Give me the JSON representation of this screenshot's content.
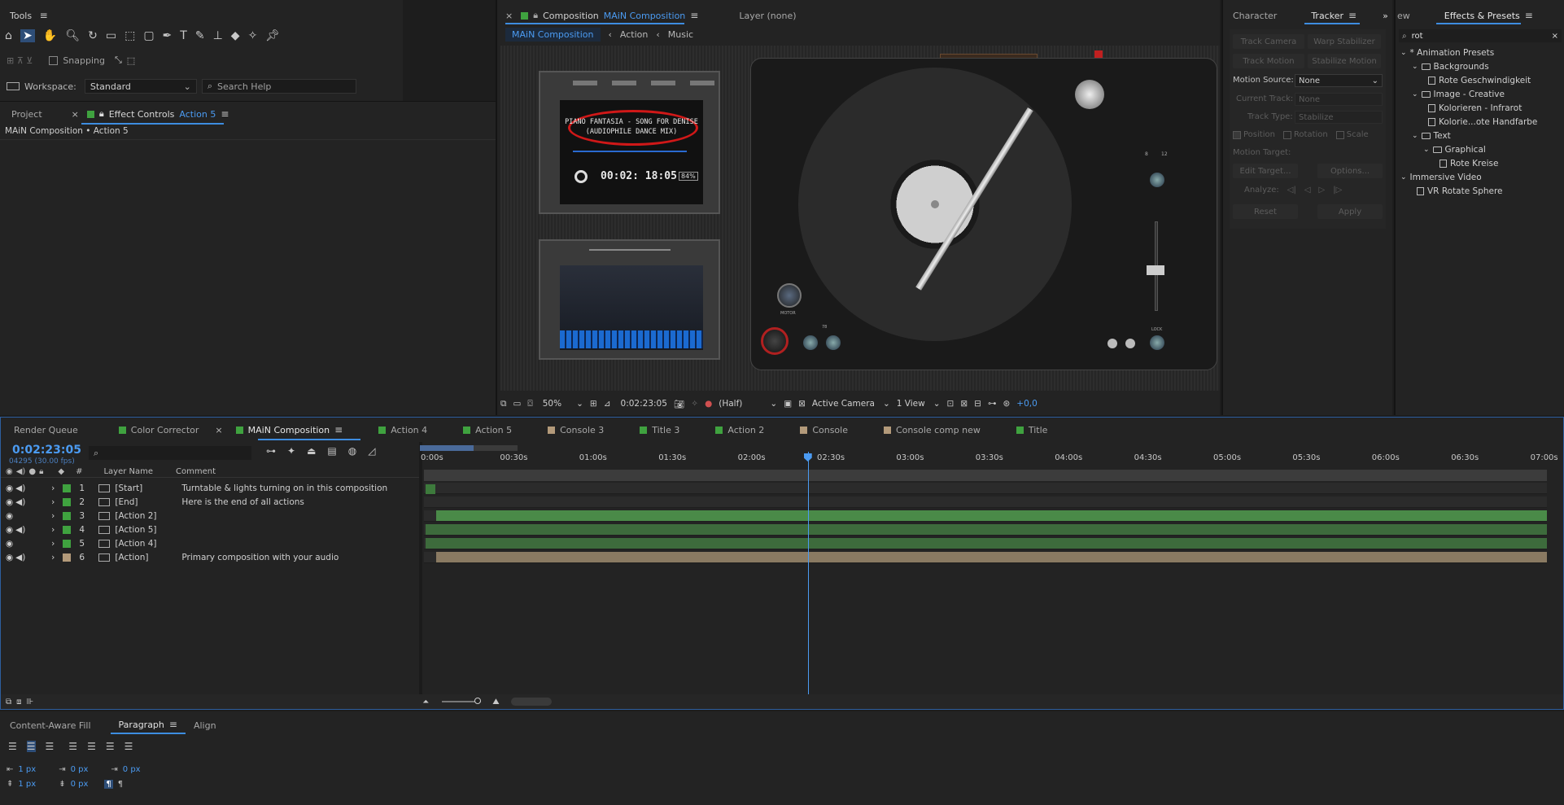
{
  "tools": {
    "title": "Tools",
    "snapping_label": "Snapping",
    "workspace_label": "Workspace:",
    "workspace_value": "Standard",
    "search_placeholder": "Search Help"
  },
  "project_panel": {
    "tabs": [
      "Project",
      "Effect Controls",
      "Action 5"
    ],
    "breadcrumb": "MAiN Composition • Action 5"
  },
  "comp_viewer": {
    "title_prefix": "Composition",
    "title_name": "MAiN Composition",
    "layer_tab": "Layer (none)",
    "breadcrumbs": [
      "MAiN Composition",
      "Action",
      "Music"
    ],
    "screen_line1": "PIANO FANTASIA - SONG FOR DENISE",
    "screen_line2": "(AUDIOPHILE DANCE MIX)",
    "screen_time": "00:02: 18:05",
    "screen_pct": "84%",
    "label_motor": "MOTOR",
    "label_lock": "LOCK",
    "label_78": "78",
    "label_8": "8",
    "label_12": "12",
    "footer": {
      "zoom": "50%",
      "timecode": "0:02:23:05",
      "resolution": "(Half)",
      "camera": "Active Camera",
      "views": "1 View",
      "exposure": "+0,0"
    }
  },
  "tracker": {
    "tabs": [
      "Character",
      "Tracker"
    ],
    "buttons": [
      "Track Camera",
      "Warp Stabilizer",
      "Track Motion",
      "Stabilize Motion"
    ],
    "motion_source_label": "Motion Source:",
    "motion_source_value": "None",
    "current_track_label": "Current Track:",
    "current_track_value": "None",
    "track_type_label": "Track Type:",
    "track_type_value": "Stabilize",
    "checkboxes": [
      "Position",
      "Rotation",
      "Scale"
    ],
    "motion_target_label": "Motion Target:",
    "edit_target": "Edit Target...",
    "options": "Options...",
    "analyze_label": "Analyze:",
    "reset": "Reset",
    "apply": "Apply"
  },
  "effects": {
    "tabs": [
      "ew",
      "Effects & Presets"
    ],
    "search_value": "rot",
    "tree": [
      {
        "label": "* Animation Presets",
        "kind": "group"
      },
      {
        "label": "Backgrounds",
        "kind": "folder"
      },
      {
        "label": "Rote Geschwindigkeit",
        "kind": "preset"
      },
      {
        "label": "Image - Creative",
        "kind": "folder"
      },
      {
        "label": "Kolorieren - Infrarot",
        "kind": "preset"
      },
      {
        "label": "Kolorie...ote Handfarbe",
        "kind": "preset"
      },
      {
        "label": "Text",
        "kind": "folder"
      },
      {
        "label": "Graphical",
        "kind": "folder"
      },
      {
        "label": "Rote Kreise",
        "kind": "preset"
      },
      {
        "label": "Immersive Video",
        "kind": "group"
      },
      {
        "label": "VR Rotate Sphere",
        "kind": "preset"
      }
    ]
  },
  "timeline": {
    "tabs": [
      {
        "label": "Render Queue",
        "color": ""
      },
      {
        "label": "Color Corrector",
        "color": "#3fa23f"
      },
      {
        "label": "MAiN Composition",
        "color": "#3fa23f"
      },
      {
        "label": "Action 4",
        "color": "#3fa23f"
      },
      {
        "label": "Action 5",
        "color": "#3fa23f"
      },
      {
        "label": "Console 3",
        "color": "#b39a7a"
      },
      {
        "label": "Title 3",
        "color": "#3fa23f"
      },
      {
        "label": "Action 2",
        "color": "#3fa23f"
      },
      {
        "label": "Console",
        "color": "#b39a7a"
      },
      {
        "label": "Console comp new",
        "color": "#b39a7a"
      },
      {
        "label": "Title",
        "color": "#3fa23f"
      }
    ],
    "current_time": "0:02:23:05",
    "frame_info": "04295 (30.00 fps)",
    "col_layer_name": "Layer Name",
    "col_comment": "Comment",
    "col_hash": "#",
    "ruler": [
      "0:00s",
      "00:30s",
      "01:00s",
      "01:30s",
      "02:00s",
      "02:30s",
      "03:00s",
      "03:30s",
      "04:00s",
      "04:30s",
      "05:00s",
      "05:30s",
      "06:00s",
      "06:30s",
      "07:00s"
    ],
    "playhead_seconds": 143.17,
    "duration_seconds": 420,
    "layers": [
      {
        "num": "1",
        "name": "[Start]",
        "comment": "Turntable & lights turning on in this composition",
        "color": "#3fa23f",
        "bar_color": "",
        "bar_start": 0,
        "bar_end": 0
      },
      {
        "num": "2",
        "name": "[End]",
        "comment": "Here is the end of all actions",
        "color": "#3fa23f",
        "bar_color": "",
        "bar_start": 0,
        "bar_end": 0
      },
      {
        "num": "3",
        "name": "[Action 2]",
        "comment": "",
        "color": "#3fa23f",
        "bar_color": "#4a8a48",
        "bar_start": 4,
        "bar_end": 420
      },
      {
        "num": "4",
        "name": "[Action 5]",
        "comment": "",
        "color": "#3fa23f",
        "bar_color": "#3d6b3c",
        "bar_start": 0,
        "bar_end": 420
      },
      {
        "num": "5",
        "name": "[Action 4]",
        "comment": "",
        "color": "#3fa23f",
        "bar_color": "#3d6b3c",
        "bar_start": 0,
        "bar_end": 420
      },
      {
        "num": "6",
        "name": "[Action]",
        "comment": "Primary composition with your audio",
        "color": "#b39a7a",
        "bar_color": "#8a7a62",
        "bar_start": 4,
        "bar_end": 420
      }
    ]
  },
  "paragraph": {
    "tabs": [
      "Content-Aware Fill",
      "Paragraph",
      "Align"
    ],
    "indent_left": "1 px",
    "indent_first": "0 px",
    "indent_right": "0 px",
    "space_before": "1 px",
    "space_after": "0 px"
  }
}
